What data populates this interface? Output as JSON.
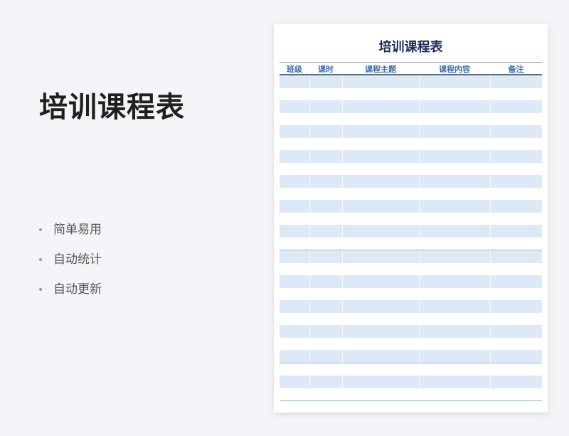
{
  "hero": {
    "title": "培训课程表"
  },
  "features": [
    "简单易用",
    "自动统计",
    "自动更新"
  ],
  "sheet": {
    "title": "培训课程表",
    "columns": [
      "班级",
      "课时",
      "课程主题",
      "课程内容",
      "备注"
    ],
    "rows": [
      [
        "",
        "",
        "",
        "",
        ""
      ],
      [
        "",
        "",
        "",
        "",
        ""
      ],
      [
        "",
        "",
        "",
        "",
        ""
      ],
      [
        "",
        "",
        "",
        "",
        ""
      ],
      [
        "",
        "",
        "",
        "",
        ""
      ],
      [
        "",
        "",
        "",
        "",
        ""
      ],
      [
        "",
        "",
        "",
        "",
        ""
      ],
      [
        "",
        "",
        "",
        "",
        ""
      ],
      [
        "",
        "",
        "",
        "",
        ""
      ],
      [
        "",
        "",
        "",
        "",
        ""
      ],
      [
        "",
        "",
        "",
        "",
        ""
      ],
      [
        "",
        "",
        "",
        "",
        ""
      ],
      [
        "",
        "",
        "",
        "",
        ""
      ],
      [
        "",
        "",
        "",
        "",
        ""
      ],
      [
        "",
        "",
        "",
        "",
        ""
      ],
      [
        "",
        "",
        "",
        "",
        ""
      ],
      [
        "",
        "",
        "",
        "",
        ""
      ],
      [
        "",
        "",
        "",
        "",
        ""
      ],
      [
        "",
        "",
        "",
        "",
        ""
      ],
      [
        "",
        "",
        "",
        "",
        ""
      ],
      [
        "",
        "",
        "",
        "",
        ""
      ],
      [
        "",
        "",
        "",
        "",
        ""
      ],
      [
        "",
        "",
        "",
        "",
        ""
      ],
      [
        "",
        "",
        "",
        "",
        ""
      ],
      [
        "",
        "",
        "",
        "",
        ""
      ],
      [
        "",
        "",
        "",
        "",
        ""
      ]
    ]
  },
  "colors": {
    "header_text": "#3a6fb0",
    "row_shade": "#dde9f6",
    "title": "#1e2a5a"
  }
}
